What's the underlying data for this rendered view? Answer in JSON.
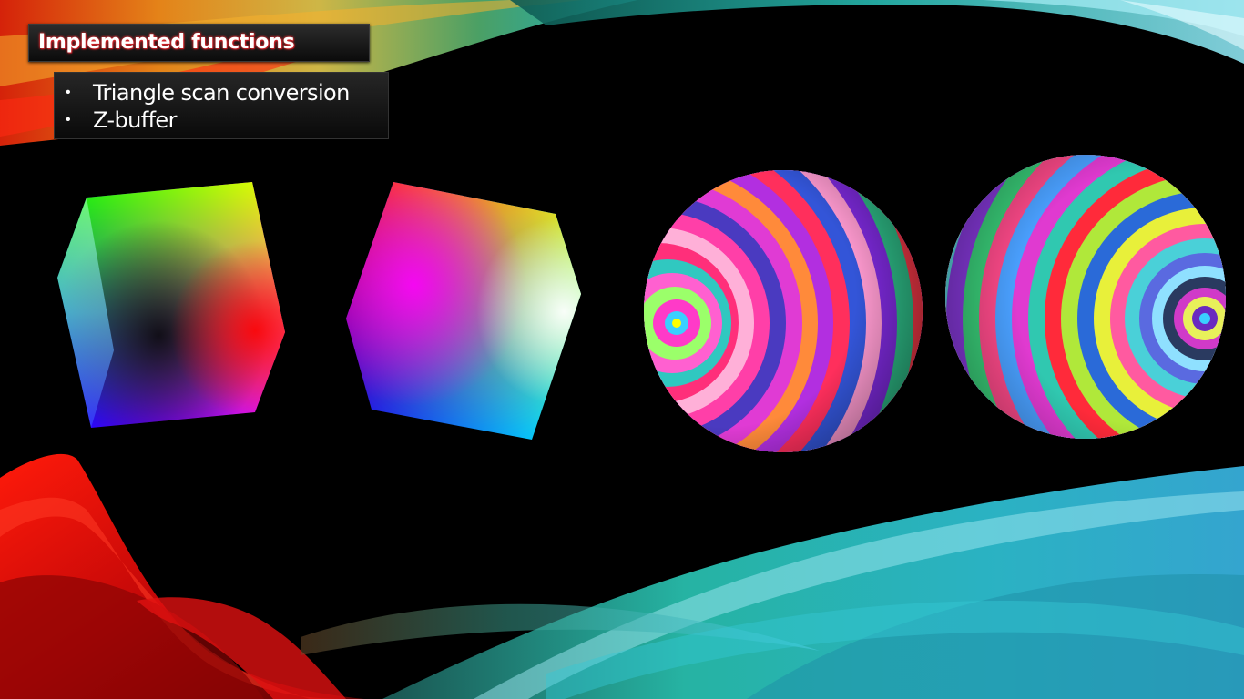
{
  "slide": {
    "title": "Implemented functions",
    "bullets": [
      {
        "label": "Triangle scan conversion"
      },
      {
        "label": "Z-buffer"
      }
    ]
  },
  "figures": [
    {
      "name": "vertex-color-cube-1"
    },
    {
      "name": "vertex-color-cube-2"
    },
    {
      "name": "rainbow-sphere-1"
    },
    {
      "name": "rainbow-sphere-2"
    }
  ],
  "colors": {
    "title_glow": "#e0292f",
    "background": "#000000",
    "wave_red": "#d10a0a",
    "wave_cyan": "#27c7d8"
  }
}
